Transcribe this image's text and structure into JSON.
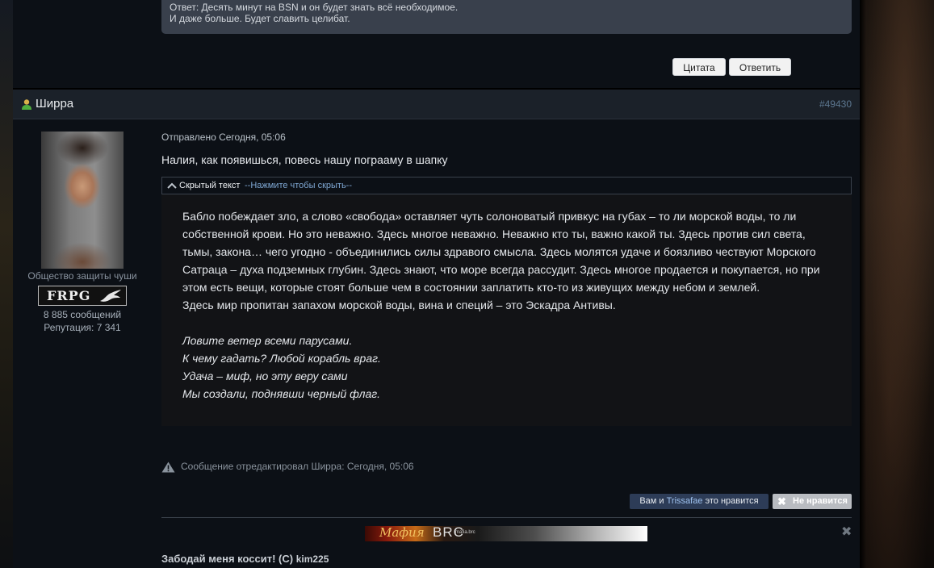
{
  "previous_post": {
    "quote_lines": [
      "Ответ: Десять минут на BSN и он будет знать всё необходимое.",
      "И даже больше. Будет славить целибат."
    ],
    "quote_button": "Цитата",
    "reply_button": "Ответить"
  },
  "post": {
    "author": "Ширра",
    "post_number": "#49430",
    "author_title": "Общество защиты чуши",
    "badge_text": "FRPG",
    "messages_count": "8 885 сообщений",
    "reputation": "Репутация: 7 341",
    "date": "Отправлено Сегодня, 05:06",
    "text": "Налия, как появишься, повесь нашу пограаму в шапку",
    "spoiler": {
      "label": "Скрытый текст",
      "toggle": "--Нажмите чтобы скрыть--",
      "paragraphs": [
        "Бабло побеждает зло, а слово «свобода» оставляет чуть солоноватый привкус на губах – то ли морской воды, то ли",
        "собственной крови. Но это неважно. Здесь многое неважно. Неважно кто ты, важно какой ты. Здесь против сил света,",
        "тьмы, закона… чего угодно - объединились силы здравого смысла. Здесь молятся удаче и боязливо чествуют Морского",
        "Сатраца – духа подземных глубин. Здесь знают, что море всегда рассудит. Здесь многое продается и покупается, но при",
        "этом есть вещи, которые стоят больше чем в состоянии заплатить кто-то из живущих между небом и землей.",
        "Здесь мир пропитан запахом морской воды, вина и специй – это Эскадра Антивы."
      ],
      "poem": [
        "Ловите ветер всеми парусами.",
        "К чему гадать? Любой корабль враг.",
        "Удача – миф, но эту веру сами",
        "Мы создали, поднявши черный флаг."
      ]
    },
    "edit_note": "Сообщение отредактировал Ширра: Сегодня, 05:06",
    "likes": {
      "prefix": "Вам и ",
      "name": "Trissafae",
      "suffix": " это нравится"
    },
    "dislike_button": "Не нравится",
    "signature": {
      "banner_text_1": "Мафия",
      "banner_text_2": "BRC",
      "banner_text_3": "mafia.brc",
      "close_glyph": "✖",
      "quote": "Забодай меня коссит! (С) ",
      "quote_author": "kim225"
    }
  }
}
